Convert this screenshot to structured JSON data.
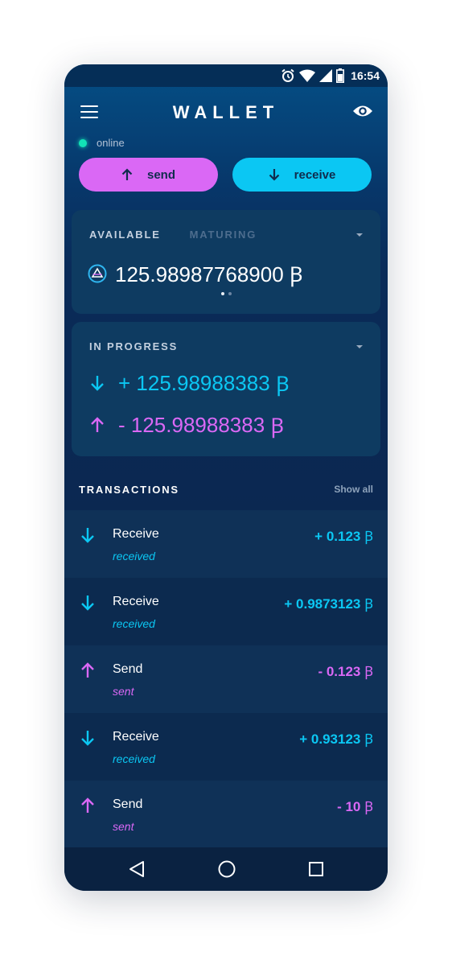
{
  "status_bar": {
    "time": "16:54"
  },
  "header": {
    "title": "WALLET"
  },
  "connection": {
    "status": "online"
  },
  "actions": {
    "send_label": "send",
    "receive_label": "receive"
  },
  "balance": {
    "tabs": [
      "AVAILABLE",
      "MATURING"
    ],
    "active_tab": "AVAILABLE",
    "amount": "125.98987768900",
    "currency": "Ꞵ"
  },
  "in_progress": {
    "title": "IN PROGRESS",
    "incoming": "+ 125.98988383",
    "outgoing": "- 125.98988383",
    "currency": "Ꞵ"
  },
  "transactions": {
    "title": "TRANSACTIONS",
    "show_all": "Show all",
    "items": [
      {
        "type": "Receive",
        "status": "received",
        "amount": "+ 0.123",
        "currency": "Ꞵ",
        "direction": "in"
      },
      {
        "type": "Receive",
        "status": "received",
        "amount": "+ 0.9873123",
        "currency": "Ꞵ",
        "direction": "in"
      },
      {
        "type": "Send",
        "status": "sent",
        "amount": "- 0.123",
        "currency": "Ꞵ",
        "direction": "out"
      },
      {
        "type": "Receive",
        "status": "received",
        "amount": "+ 0.93123",
        "currency": "Ꞵ",
        "direction": "in"
      },
      {
        "type": "Send",
        "status": "sent",
        "amount": "- 10",
        "currency": "Ꞵ",
        "direction": "out"
      }
    ]
  },
  "colors": {
    "receive": "#0bc7f3",
    "send": "#da68f5",
    "online": "#12e3b6",
    "background": "#0b2750"
  },
  "icons": [
    "alarm-icon",
    "wifi-icon",
    "signal-icon",
    "battery-icon",
    "menu-icon",
    "eye-icon",
    "arrow-up-icon",
    "arrow-down-icon",
    "beam-logo-icon",
    "back-icon",
    "home-icon",
    "recents-icon"
  ]
}
